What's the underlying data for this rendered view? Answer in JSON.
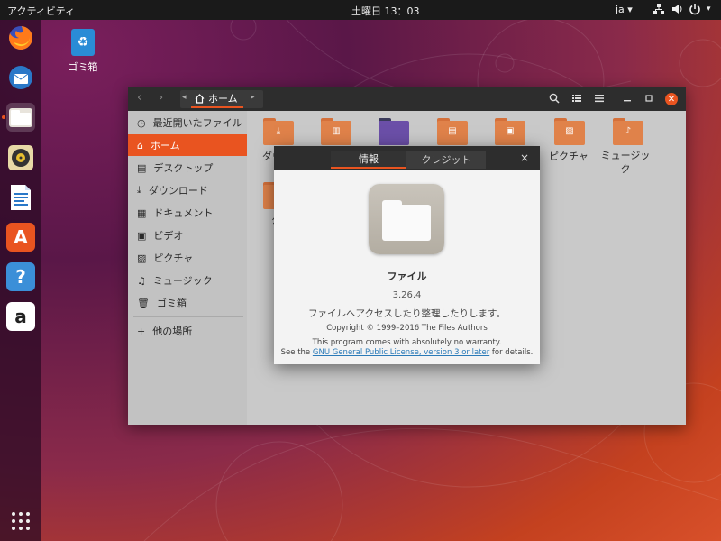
{
  "topbar": {
    "activities": "アクティビティ",
    "clock": "土曜日 13：03",
    "lang": "ja ▾",
    "network_icon": "network-icon",
    "volume_icon": "volume-icon",
    "power_icon": "power-icon"
  },
  "dock": {
    "apps": [
      "firefox-icon",
      "thunderbird-icon",
      "files-icon",
      "rhythmbox-icon",
      "writer-icon",
      "software-icon",
      "help-icon",
      "amazon-icon"
    ],
    "help_glyph": "?",
    "amazon_glyph": "a",
    "software_glyph": "A",
    "show_apps_icon": "grid-icon"
  },
  "desktop": {
    "trash_label": "ゴミ箱"
  },
  "files_window": {
    "path_home": "ホーム",
    "sidebar": [
      {
        "label": "最近開いたファイル",
        "icon": "clock-icon"
      },
      {
        "label": "ホーム",
        "icon": "home-icon"
      },
      {
        "label": "デスクトップ",
        "icon": "desktop-icon"
      },
      {
        "label": "ダウンロード",
        "icon": "download-icon"
      },
      {
        "label": "ドキュメント",
        "icon": "document-icon"
      },
      {
        "label": "ビデオ",
        "icon": "video-icon"
      },
      {
        "label": "ピクチャ",
        "icon": "picture-icon"
      },
      {
        "label": "ミュージック",
        "icon": "music-icon"
      },
      {
        "label": "ゴミ箱",
        "icon": "trash-icon"
      },
      {
        "label": "他の場所",
        "icon": "plus-icon"
      }
    ],
    "folders": [
      {
        "label": "ダウ"
      },
      {
        "label": ""
      },
      {
        "label": ""
      },
      {
        "label": ""
      },
      {
        "label": ""
      },
      {
        "label": "ピクチャ"
      },
      {
        "label": "ミュージック"
      },
      {
        "label": "公"
      }
    ]
  },
  "about_dialog": {
    "tab_info": "情報",
    "tab_credits": "クレジット",
    "app_name": "ファイル",
    "version": "3.26.4",
    "description": "ファイルへアクセスしたり整理したりします。",
    "copyright": "Copyright © 1999–2016 The Files Authors",
    "warranty_line1": "This program comes with absolutely no warranty.",
    "warranty_see": "See the ",
    "warranty_link": "GNU General Public License, version 3 or later",
    "warranty_end": " for details.",
    "close_glyph": "×"
  },
  "colors": {
    "accent": "#e95420",
    "topbar": "#1a1a1a",
    "headerbar": "#2d2d2d"
  }
}
